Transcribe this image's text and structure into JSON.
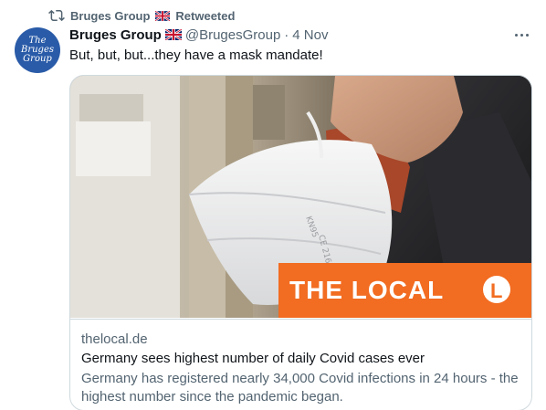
{
  "retweet": {
    "user": "Bruges Group",
    "label": "Retweeted"
  },
  "avatar": {
    "line1": "The",
    "line2": "Bruges",
    "line3": "Group"
  },
  "tweet": {
    "author": "Bruges Group",
    "handle": "@BrugesGroup",
    "separator": "·",
    "date": "4 Nov",
    "text": "But, but, but...they have a mask mandate!"
  },
  "card": {
    "domain": "thelocal.de",
    "title": "Germany sees highest number of daily Covid cases ever",
    "description": "Germany has registered nearly 34,000 Covid infections in 24 hours - the highest number since the pandemic began.",
    "image_brand": "THE LOCAL",
    "image_brand_logo": "L",
    "mask_print_1": "KN95",
    "mask_print_2": "CE 2163",
    "brand_color": "#f26c21"
  },
  "colors": {
    "secondary_text": "#536471",
    "primary_text": "#0f1419",
    "border": "#cfd9de"
  }
}
